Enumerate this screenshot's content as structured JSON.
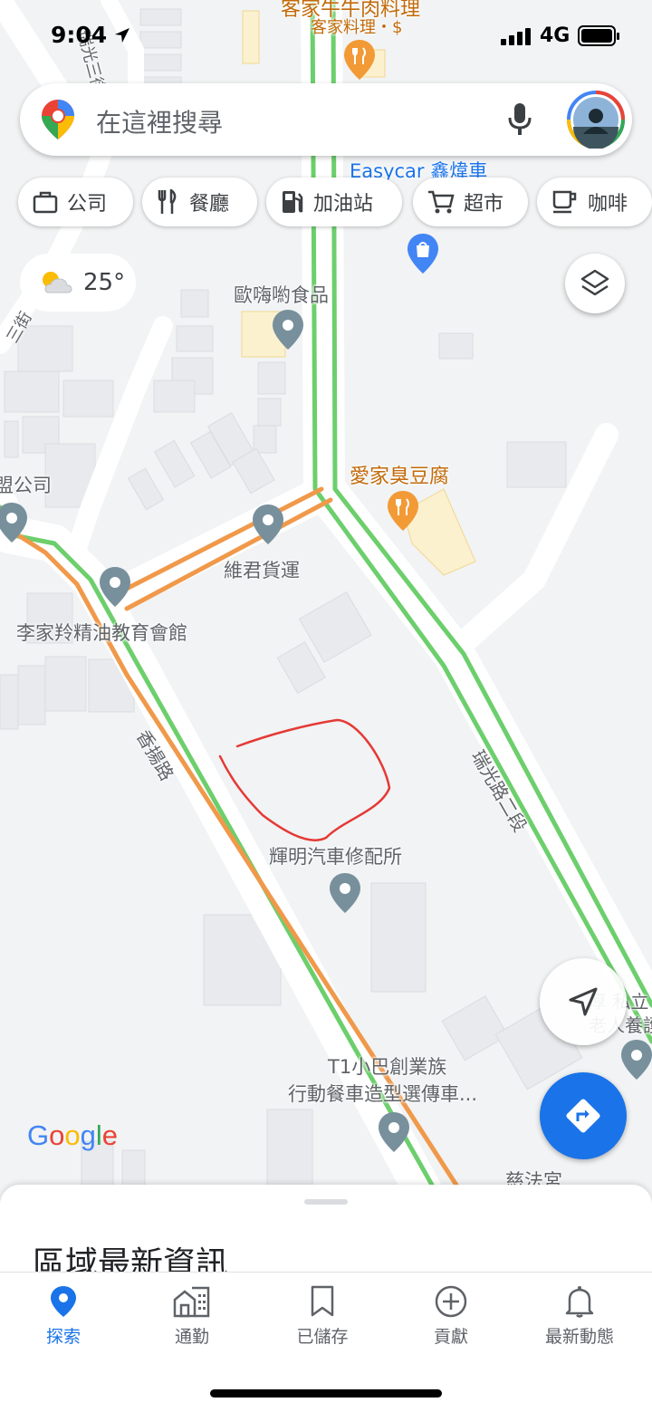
{
  "status_bar": {
    "time": "9:04",
    "network": "4G"
  },
  "search": {
    "placeholder": "在這裡搜尋"
  },
  "chips": [
    {
      "label": "公司",
      "icon": "briefcase-icon"
    },
    {
      "label": "餐廳",
      "icon": "restaurant-icon"
    },
    {
      "label": "加油站",
      "icon": "gas-station-icon"
    },
    {
      "label": "超市",
      "icon": "cart-icon"
    },
    {
      "label": "咖啡",
      "icon": "coffee-icon"
    }
  ],
  "weather": {
    "temperature": "25°",
    "icon": "partly-cloudy-icon"
  },
  "map_labels": {
    "restaurant_top_name": "客家牛牛肉料理",
    "restaurant_top_sub": "客家料理・$",
    "easycar": "Easycar 鑫煒車",
    "oumiyo": "歐嗨喲食品",
    "aijia": "愛家臭豆腐",
    "company_left": "盟公司",
    "weijun": "維君貨運",
    "lijia": "李家羚精油教育會館",
    "xiangyang_road": "香揚路",
    "ruiguang_road": "瑞光路二段",
    "huiming": "輝明汽車修配所",
    "t1_line1": "T1小巴創業族",
    "t1_line2": "行動餐車造型選傳車...",
    "cifa": "慈法宮",
    "right_partial_1": "厚 私立",
    "right_partial_2": "老人養護",
    "street_top": "瑞光三街",
    "street_left": "三街",
    "google_logo": "Google"
  },
  "sheet": {
    "title": "區域最新資訊"
  },
  "nav": [
    {
      "label": "探索",
      "icon": "explore-pin-icon",
      "active": true
    },
    {
      "label": "通勤",
      "icon": "commute-icon",
      "active": false
    },
    {
      "label": "已儲存",
      "icon": "bookmark-icon",
      "active": false
    },
    {
      "label": "貢獻",
      "icon": "add-circle-icon",
      "active": false
    },
    {
      "label": "最新動態",
      "icon": "bell-icon",
      "active": false
    }
  ],
  "colors": {
    "accent": "#1a73e8",
    "traffic_green": "#6ccf6c",
    "traffic_orange": "#f0994a",
    "annotation": "#e53935"
  }
}
